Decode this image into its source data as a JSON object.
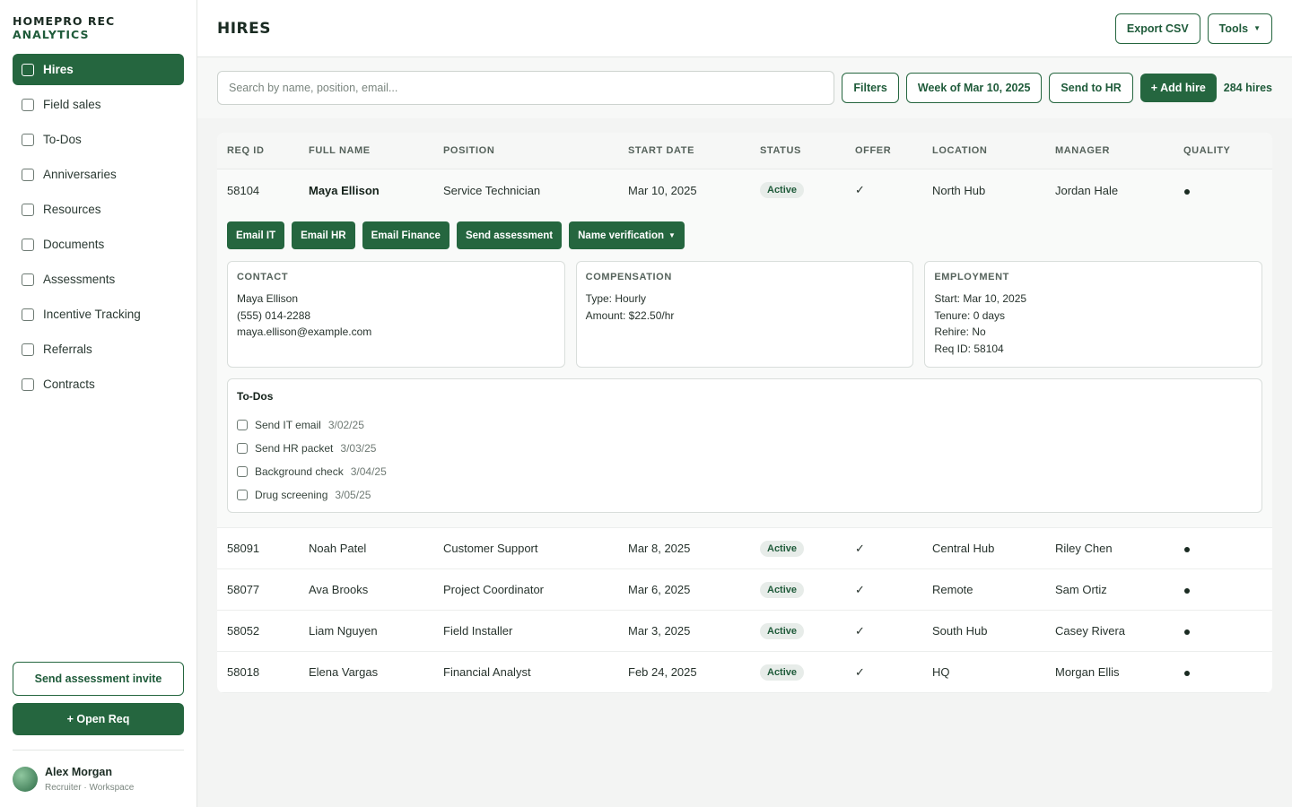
{
  "brand": {
    "line1": "HOMEPRO REC",
    "line2": "ANALYTICS"
  },
  "sidebar": {
    "items": [
      {
        "label": "Hires",
        "active": true
      },
      {
        "label": "Field sales"
      },
      {
        "label": "To-Dos"
      },
      {
        "label": "Anniversaries"
      },
      {
        "label": "Resources"
      },
      {
        "label": "Documents"
      },
      {
        "label": "Assessments"
      },
      {
        "label": "Incentive Tracking"
      },
      {
        "label": "Referrals"
      },
      {
        "label": "Contracts"
      }
    ],
    "send_invite_label": "Send assessment invite",
    "open_req_label": "+ Open Req",
    "user": {
      "name": "Alex Morgan",
      "role": "Recruiter · Workspace"
    }
  },
  "header": {
    "title": "HIRES",
    "export_label": "Export CSV",
    "tools_label": "Tools"
  },
  "toolbar": {
    "search_placeholder": "Search by name, position, email...",
    "filters_label": "Filters",
    "week_label": "Week of Mar 10, 2025",
    "send_hr_label": "Send to HR",
    "add_hire_label": "+ Add hire",
    "count": "284 hires"
  },
  "table": {
    "columns": [
      "REQ ID",
      "FULL NAME",
      "POSITION",
      "START DATE",
      "STATUS",
      "OFFER",
      "LOCATION",
      "MANAGER",
      "QUALITY"
    ],
    "rows": [
      {
        "req": "58104",
        "name": "Maya Ellison",
        "position": "Service Technician",
        "start": "Mar 10, 2025",
        "status": "Active",
        "offer": "✓",
        "location": "North Hub",
        "manager": "Jordan Hale"
      },
      {
        "req": "58091",
        "name": "Noah Patel",
        "position": "Customer Support",
        "start": "Mar 8, 2025",
        "status": "Active",
        "offer": "✓",
        "location": "Central Hub",
        "manager": "Riley Chen"
      },
      {
        "req": "58077",
        "name": "Ava Brooks",
        "position": "Project Coordinator",
        "start": "Mar 6, 2025",
        "status": "Active",
        "offer": "✓",
        "location": "Remote",
        "manager": "Sam Ortiz"
      },
      {
        "req": "58052",
        "name": "Liam Nguyen",
        "position": "Field Installer",
        "start": "Mar 3, 2025",
        "status": "Active",
        "offer": "✓",
        "location": "South Hub",
        "manager": "Casey Rivera"
      },
      {
        "req": "58018",
        "name": "Elena Vargas",
        "position": "Financial Analyst",
        "start": "Feb 24, 2025",
        "status": "Active",
        "offer": "✓",
        "location": "HQ",
        "manager": "Morgan Ellis"
      }
    ]
  },
  "detail": {
    "actions": {
      "email_it": "Email IT",
      "email_hr": "Email HR",
      "email_finance": "Email Finance",
      "send_assessment": "Send assessment",
      "name_verification": "Name verification"
    },
    "contact": {
      "title": "CONTACT",
      "name": "Maya Ellison",
      "phone": "(555) 014-2288",
      "email": "maya.ellison@example.com"
    },
    "compensation": {
      "title": "COMPENSATION",
      "type": "Type: Hourly",
      "amount": "Amount: $22.50/hr"
    },
    "employment": {
      "title": "EMPLOYMENT",
      "start": "Start: Mar 10, 2025",
      "tenure": "Tenure: 0 days",
      "rehire": "Rehire: No",
      "req": "Req ID: 58104"
    },
    "todos": {
      "title": "To-Dos",
      "items": [
        {
          "label": "Send IT email",
          "date": "3/02/25"
        },
        {
          "label": "Send HR packet",
          "date": "3/03/25"
        },
        {
          "label": "Background check",
          "date": "3/04/25"
        },
        {
          "label": "Drug screening",
          "date": "3/05/25"
        }
      ]
    }
  }
}
